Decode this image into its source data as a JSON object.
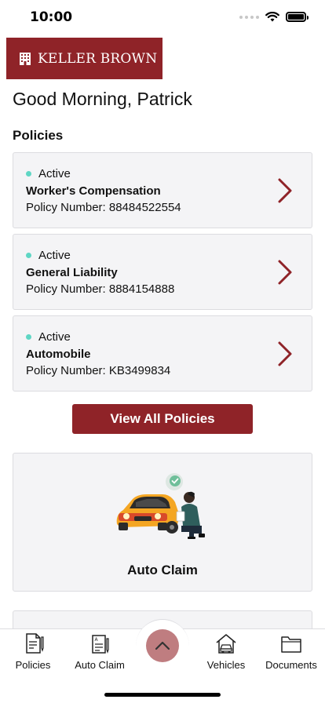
{
  "status_bar": {
    "time": "10:00"
  },
  "brand": {
    "name": "KELLER BROWN",
    "color": "#8f2328"
  },
  "greeting": "Good Morning, Patrick",
  "policies_section": {
    "title": "Policies",
    "items": [
      {
        "status": "Active",
        "name": "Worker's Compensation",
        "number": "Policy Number: 88484522554"
      },
      {
        "status": "Active",
        "name": "General Liability",
        "number": "Policy Number: 8884154888"
      },
      {
        "status": "Active",
        "name": "Automobile",
        "number": "Policy Number: KB3499834"
      }
    ],
    "view_all_label": "View All Policies"
  },
  "auto_claim": {
    "title": "Auto Claim"
  },
  "tab_bar": {
    "tabs": [
      {
        "label": "Policies",
        "icon": "policies-icon"
      },
      {
        "label": "Auto Claim",
        "icon": "auto-claim-icon"
      },
      {
        "label": "Vehicles",
        "icon": "vehicles-icon"
      },
      {
        "label": "Documents",
        "icon": "documents-icon"
      }
    ],
    "center_button_icon": "chevron-up-icon"
  },
  "colors": {
    "accent": "#8f2328",
    "active_dot": "#5fd6c4",
    "fab": "#bf7d80",
    "card_bg": "#f4f4f6"
  }
}
